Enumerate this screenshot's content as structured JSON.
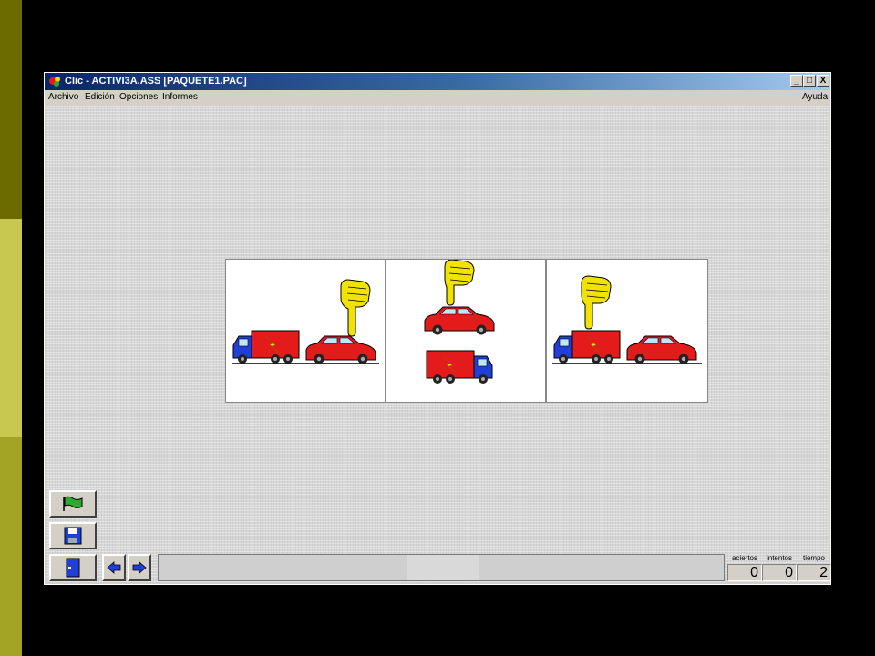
{
  "window": {
    "title": "Clic - ACTIVI3A.ASS [PAQUETE1.PAC]",
    "controls": [
      "_",
      "□",
      "X"
    ]
  },
  "menu": {
    "items": [
      "Archivo",
      "Edición",
      "Opciones",
      "Informes"
    ],
    "help": "Ayuda"
  },
  "toolbar": {
    "icons": [
      "flag-icon",
      "save-icon",
      "exit-door-icon",
      "arrow-left-icon",
      "arrow-right-icon"
    ]
  },
  "counters": {
    "aciertos": {
      "label": "aciertos",
      "value": "0"
    },
    "intentos": {
      "label": "intentos",
      "value": "0"
    },
    "tiempo": {
      "label": "tiempo",
      "value": "2"
    }
  },
  "colors": {
    "titlebar": "#0a246a",
    "truck_cargo": "#e31b1b",
    "truck_cab": "#1f3fd6",
    "car": "#e31b1b",
    "hand": "#f2e200",
    "flag": "#2fa82f"
  }
}
